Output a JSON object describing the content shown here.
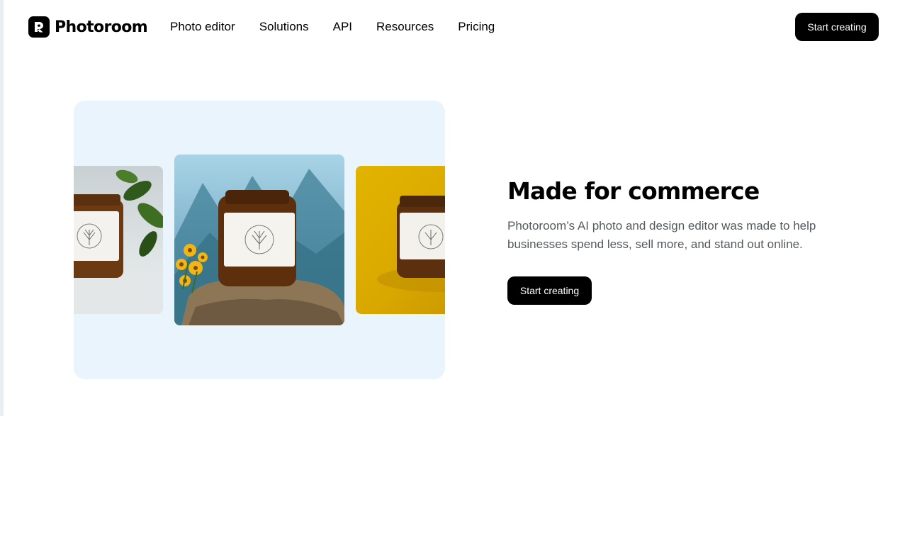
{
  "brand": {
    "name": "Photoroom"
  },
  "nav": {
    "items": [
      "Photo editor",
      "Solutions",
      "API",
      "Resources",
      "Pricing"
    ]
  },
  "header": {
    "cta_label": "Start creating"
  },
  "hero": {
    "title": "Made for commerce",
    "description": "Photoroom’s AI photo and design editor was made to help businesses spend less, sell more, and stand out online.",
    "cta_label": "Start creating"
  },
  "colors": {
    "accent": "#000000",
    "card_background": "#eaf4fd",
    "body_text": "#555a5f"
  },
  "icons": {
    "logo": "photoroom-logo-icon"
  }
}
